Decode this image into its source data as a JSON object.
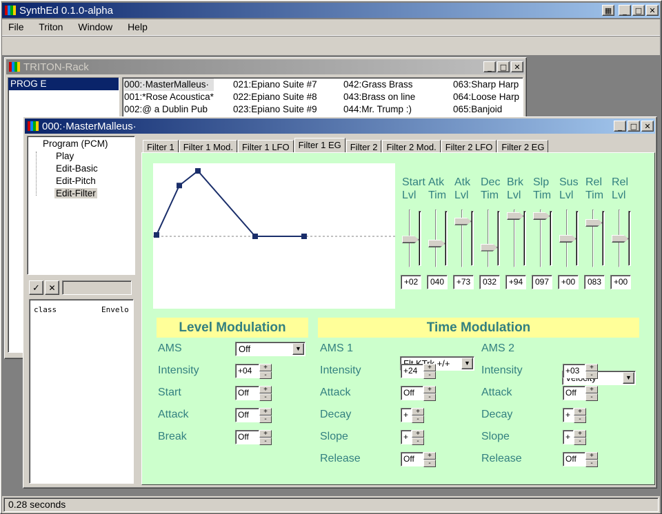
{
  "app": {
    "title": "SynthEd 0.1.0-alpha",
    "menu": [
      "File",
      "Triton",
      "Window",
      "Help"
    ],
    "status": "0.28 seconds"
  },
  "rack": {
    "title": "TRITON-Rack",
    "bank": "PROG E",
    "programs": [
      "000:·MasterMalleus·",
      "001:*Rose Acoustica*",
      "002:@ a Dublin Pub",
      "021:Epiano Suite #7",
      "022:Epiano Suite #8",
      "023:Epiano Suite #9",
      "042:Grass Brass",
      "043:Brass on line",
      "044:Mr. Trump :)",
      "063:Sharp Harp",
      "064:Loose Harp",
      "065:Banjoid"
    ]
  },
  "editor": {
    "title": "000:·MasterMalleus·",
    "tree": {
      "root": "Program (PCM)",
      "children": [
        "Play",
        "Edit-Basic",
        "Edit-Pitch",
        "Edit-Filter"
      ]
    },
    "bottom_left": {
      "col1": "class",
      "col2": "Envelo"
    },
    "tabs": [
      "Filter 1",
      "Filter 1 Mod.",
      "Filter 1 LFO",
      "Filter 1 EG",
      "Filter 2",
      "Filter 2 Mod.",
      "Filter 2 LFO",
      "Filter 2 EG"
    ],
    "selected_tab": "Filter 1 EG",
    "envelope_points": [
      {
        "stage": "Start",
        "level": 2
      },
      {
        "stage": "Attack",
        "level": 73
      },
      {
        "stage": "Break",
        "level": 94
      },
      {
        "stage": "Sustain",
        "level": 0
      },
      {
        "stage": "Release",
        "level": 0
      }
    ],
    "faders": [
      {
        "l1": "Start",
        "l2": "Lvl",
        "value": "+02",
        "level": 0.48
      },
      {
        "l1": "Atk",
        "l2": "Tim",
        "value": "040",
        "level": 0.4
      },
      {
        "l1": "Atk",
        "l2": "Lvl",
        "value": "+73",
        "level": 0.86
      },
      {
        "l1": "Dec",
        "l2": "Tim",
        "value": "032",
        "level": 0.32
      },
      {
        "l1": "Brk",
        "l2": "Lvl",
        "value": "+94",
        "level": 0.97
      },
      {
        "l1": "Slp",
        "l2": "Tim",
        "value": "097",
        "level": 0.97
      },
      {
        "l1": "Sus",
        "l2": "Lvl",
        "value": "+00",
        "level": 0.5
      },
      {
        "l1": "Rel",
        "l2": "Tim",
        "value": "083",
        "level": 0.83
      },
      {
        "l1": "Rel",
        "l2": "Lvl",
        "value": "+00",
        "level": 0.5
      }
    ],
    "level_mod": {
      "header": "Level Modulation",
      "ams_label": "AMS",
      "ams_value": "Off",
      "rows": [
        {
          "label": "Intensity",
          "value": "+04"
        },
        {
          "label": "Start",
          "value": "Off"
        },
        {
          "label": "Attack",
          "value": "Off"
        },
        {
          "label": "Break",
          "value": "Off"
        }
      ]
    },
    "time_mod": {
      "header": "Time Modulation",
      "ams1_label": "AMS 1",
      "ams1_value": "Flt KTrk +/+",
      "ams2_label": "AMS 2",
      "ams2_value": "Velocity",
      "rows1": [
        {
          "label": "Intensity",
          "value": "+24"
        },
        {
          "label": "Attack",
          "value": "Off"
        },
        {
          "label": "Decay",
          "value": "+"
        },
        {
          "label": "Slope",
          "value": "+"
        },
        {
          "label": "Release",
          "value": "Off"
        }
      ],
      "rows2": [
        {
          "label": "Intensity",
          "value": "+03"
        },
        {
          "label": "Attack",
          "value": "Off"
        },
        {
          "label": "Decay",
          "value": "+"
        },
        {
          "label": "Slope",
          "value": "+"
        },
        {
          "label": "Release",
          "value": "Off"
        }
      ]
    }
  }
}
